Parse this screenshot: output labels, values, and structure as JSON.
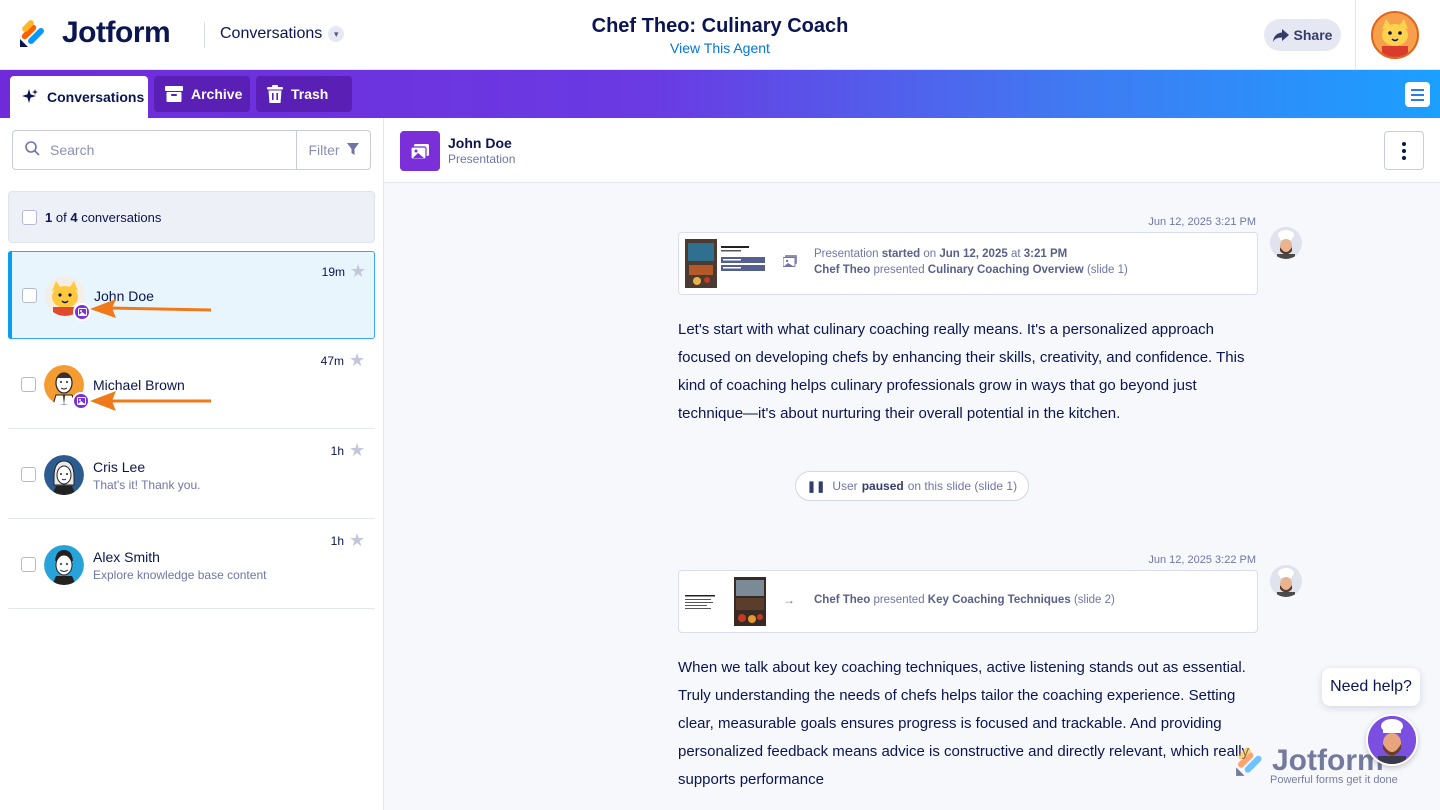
{
  "app": {
    "brand": "Jotform",
    "section_dropdown": "Conversations"
  },
  "header": {
    "title": "Chef Theo: Culinary Coach",
    "link": "View This Agent",
    "share_label": "Share"
  },
  "tabs": [
    {
      "label": "Conversations",
      "icon": "sparkle-icon",
      "active": true
    },
    {
      "label": "Archive",
      "icon": "archive-icon",
      "active": false
    },
    {
      "label": "Trash",
      "icon": "trash-icon",
      "active": false
    }
  ],
  "sidebar": {
    "search_placeholder": "Search",
    "filter_label": "Filter",
    "count": {
      "selected": "1",
      "of": "of",
      "total": "4",
      "suffix": "conversations"
    },
    "conversations": [
      {
        "name": "John Doe",
        "preview": "",
        "time": "19m",
        "selected": true,
        "badge": "presentation-icon"
      },
      {
        "name": "Michael Brown",
        "preview": "",
        "time": "47m",
        "selected": false,
        "badge": "presentation-icon"
      },
      {
        "name": "Cris Lee",
        "preview": "That's it! Thank you.",
        "time": "1h",
        "selected": false
      },
      {
        "name": "Alex Smith",
        "preview": "Explore knowledge base content",
        "time": "1h",
        "selected": false
      }
    ]
  },
  "chat": {
    "user_name": "John Doe",
    "user_subtitle": "Presentation",
    "events": [
      {
        "timestamp": "Jun 12, 2025 3:21 PM",
        "line1": {
          "a": "Presentation",
          "b": "started",
          "c": "on",
          "d": "Jun 12, 2025",
          "e": "at",
          "f": "3:21 PM"
        },
        "line2": {
          "a": "Chef Theo",
          "b": "presented",
          "c": "Culinary Coaching Overview",
          "d": "(slide 1)"
        },
        "message": "Let's start with what culinary coaching really means. It's a personalized approach focused on developing chefs by enhancing their skills, creativity, and confidence. This kind of coaching helps culinary professionals grow in ways that go beyond just technique—it's about nurturing their overall potential in the kitchen."
      },
      {
        "timestamp": "Jun 12, 2025 3:22 PM",
        "line2": {
          "a": "Chef Theo",
          "b": "presented",
          "c": "Key Coaching Techniques",
          "d": "(slide 2)"
        },
        "message": "When we talk about key coaching techniques, active listening stands out as essential. Truly understanding the needs of chefs helps tailor the coaching experience. Setting clear, measurable goals ensures progress is focused and trackable. And providing personalized feedback means advice is constructive and directly relevant, which really supports performance"
      }
    ],
    "pause_pill": {
      "a": "User",
      "b": "paused",
      "c": "on this slide (slide 1)"
    }
  },
  "help": {
    "label": "Need help?"
  },
  "watermark": {
    "brand": "Jotform",
    "tagline": "Powerful forms get it done"
  },
  "colors": {
    "brand_navy": "#0a1551",
    "accent_purple": "#7b2fd8",
    "selected_blue": "#0a9ef0",
    "arrow_orange": "#f07a1a"
  }
}
